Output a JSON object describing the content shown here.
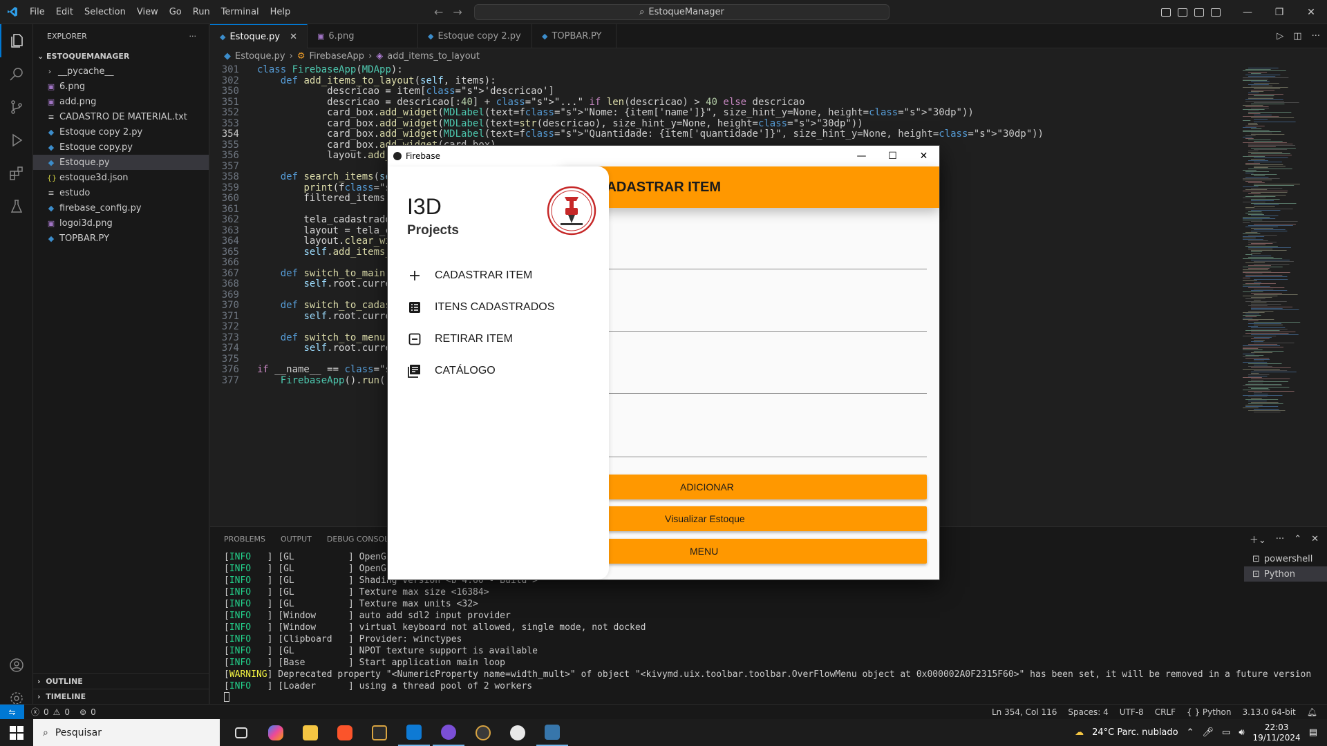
{
  "titlebar": {
    "menu": [
      "File",
      "Edit",
      "Selection",
      "View",
      "Go",
      "Run",
      "Terminal",
      "Help"
    ],
    "search_text": "EstoqueManager"
  },
  "sidebar": {
    "title": "EXPLORER",
    "project": "ESTOQUEMANAGER",
    "files": [
      {
        "name": "__pycache__",
        "type": "folder"
      },
      {
        "name": "6.png",
        "type": "image"
      },
      {
        "name": "add.png",
        "type": "image"
      },
      {
        "name": "CADASTRO DE MATERIAL.txt",
        "type": "text"
      },
      {
        "name": "Estoque copy 2.py",
        "type": "python"
      },
      {
        "name": "Estoque copy.py",
        "type": "python"
      },
      {
        "name": "Estoque.py",
        "type": "python"
      },
      {
        "name": "estoque3d.json",
        "type": "json"
      },
      {
        "name": "estudo",
        "type": "text"
      },
      {
        "name": "firebase_config.py",
        "type": "python"
      },
      {
        "name": "logoi3d.png",
        "type": "image"
      },
      {
        "name": "TOPBAR.PY",
        "type": "python"
      }
    ],
    "outline": "OUTLINE",
    "timeline": "TIMELINE"
  },
  "tabs": [
    {
      "label": "Estoque.py",
      "active": true
    },
    {
      "label": "6.png",
      "active": false
    },
    {
      "label": "Estoque copy 2.py",
      "active": false
    },
    {
      "label": "TOPBAR.PY",
      "active": false
    }
  ],
  "breadcrumb": [
    "Estoque.py",
    "FirebaseApp",
    "add_items_to_layout"
  ],
  "editor": {
    "lines": [
      {
        "n": "301",
        "code": "class FirebaseApp(MDApp):"
      },
      {
        "n": "302",
        "code": "    def add_items_to_layout(self, items):"
      },
      {
        "n": "350",
        "code": "            descricao = item['descricao']"
      },
      {
        "n": "351",
        "code": "            descricao = descricao[:40] + \"...\" if len(descricao) > 40 else descricao"
      },
      {
        "n": "352",
        "code": "            card_box.add_widget(MDLabel(text=f\"Nome: {item['name']}\", size_hint_y=None, height=\"30dp\"))"
      },
      {
        "n": "353",
        "code": "            card_box.add_widget(MDLabel(text=str(descricao), size_hint_y=None, height=\"30dp\"))"
      },
      {
        "n": "354",
        "code": "            card_box.add_widget(MDLabel(text=f\"Quantidade: {item['quantidade']}\", size_hint_y=None, height=\"30dp\"))"
      },
      {
        "n": "355",
        "code": "            card_box.add_widget(card_box)"
      },
      {
        "n": "356",
        "code": "            layout.add_widget(card)"
      },
      {
        "n": "357",
        "code": ""
      },
      {
        "n": "358",
        "code": "    def search_items(self, text):"
      },
      {
        "n": "359",
        "code": "        print(f'Pesquisando: {text}')"
      },
      {
        "n": "360",
        "code": "        filtered_items = [item for item in self.items]"
      },
      {
        "n": "361",
        "code": ""
      },
      {
        "n": "362",
        "code": "        tela_cadastrados = self.root.get_screen('itens')"
      },
      {
        "n": "363",
        "code": "        layout = tela_cadastrados.ids.layout"
      },
      {
        "n": "364",
        "code": "        layout.clear_widgets()"
      },
      {
        "n": "365",
        "code": "        self.add_items_to_layout(filtered_items)"
      },
      {
        "n": "366",
        "code": ""
      },
      {
        "n": "367",
        "code": "    def switch_to_main(self):"
      },
      {
        "n": "368",
        "code": "        self.root.current = 'main'"
      },
      {
        "n": "369",
        "code": ""
      },
      {
        "n": "370",
        "code": "    def switch_to_cadastro(self):"
      },
      {
        "n": "371",
        "code": "        self.root.current = 'cadastro'"
      },
      {
        "n": "372",
        "code": ""
      },
      {
        "n": "373",
        "code": "    def switch_to_menu(self):"
      },
      {
        "n": "374",
        "code": "        self.root.current = 'menu'"
      },
      {
        "n": "375",
        "code": ""
      },
      {
        "n": "376",
        "code": "if __name__ == '__main__':"
      },
      {
        "n": "377",
        "code": "    FirebaseApp().run()"
      }
    ],
    "current_line": "354"
  },
  "panel": {
    "tabs": [
      "PROBLEMS",
      "OUTPUT",
      "DEBUG CONSOLE"
    ],
    "terminal_lines": [
      {
        "level": "INFO   ",
        "src": "GL          ",
        "msg": "OpenGL renderer <Intel(R) UHD Graphics>"
      },
      {
        "level": "INFO   ",
        "src": "GL          ",
        "msg": "OpenGL parsed version: 4, 6"
      },
      {
        "level": "INFO   ",
        "src": "GL          ",
        "msg": "Shading version <b'4.60 - Build'>"
      },
      {
        "level": "INFO   ",
        "src": "GL          ",
        "msg": "Texture max size <16384>"
      },
      {
        "level": "INFO   ",
        "src": "GL          ",
        "msg": "Texture max units <32>"
      },
      {
        "level": "INFO   ",
        "src": "Window      ",
        "msg": "auto add sdl2 input provider"
      },
      {
        "level": "INFO   ",
        "src": "Window      ",
        "msg": "virtual keyboard not allowed, single mode, not docked"
      },
      {
        "level": "INFO   ",
        "src": "Clipboard   ",
        "msg": "Provider: winctypes"
      },
      {
        "level": "INFO   ",
        "src": "GL          ",
        "msg": "NPOT texture support is available"
      },
      {
        "level": "INFO   ",
        "src": "Base        ",
        "msg": "Start application main loop"
      },
      {
        "level": "WARNING",
        "src": "",
        "msg": "Deprecated property \"<NumericProperty name=width_mult>\" of object \"<kivymd.uix.toolbar.toolbar.OverFlowMenu object at 0x000002A0F2315F60>\" has been set, it will be removed in a future version"
      },
      {
        "level": "INFO   ",
        "src": "Loader      ",
        "msg": "using a thread pool of 2 workers"
      }
    ],
    "terminals": [
      "powershell",
      "Python"
    ]
  },
  "statusbar": {
    "errors": "0",
    "warnings": "0",
    "ports": "0",
    "position": "Ln 354, Col 116",
    "spaces": "Spaces: 4",
    "encoding": "UTF-8",
    "eol": "CRLF",
    "language": "Python",
    "interpreter": "3.13.0 64-bit"
  },
  "taskbar": {
    "search_placeholder": "Pesquisar",
    "weather": "24°C  Parc. nublado",
    "time": "22:03",
    "date": "19/11/2024"
  },
  "kivy_window": {
    "title": "Firebase",
    "drawer": {
      "title": "I3D",
      "subtitle": "Projects",
      "items": [
        {
          "label": "CADASTRAR ITEM",
          "icon": "plus-icon"
        },
        {
          "label": "ITENS CADASTRADOS",
          "icon": "list-icon"
        },
        {
          "label": "RETIRAR ITEM",
          "icon": "minus-box-icon"
        },
        {
          "label": "CATÁLOGO",
          "icon": "catalog-icon"
        }
      ]
    },
    "topbar_title": "CADASTRAR ITEM",
    "buttons": {
      "add": "ADICIONAR",
      "view": "Visualizar Estoque",
      "menu": "MENU"
    },
    "colors": {
      "accent": "#ff9800"
    }
  }
}
